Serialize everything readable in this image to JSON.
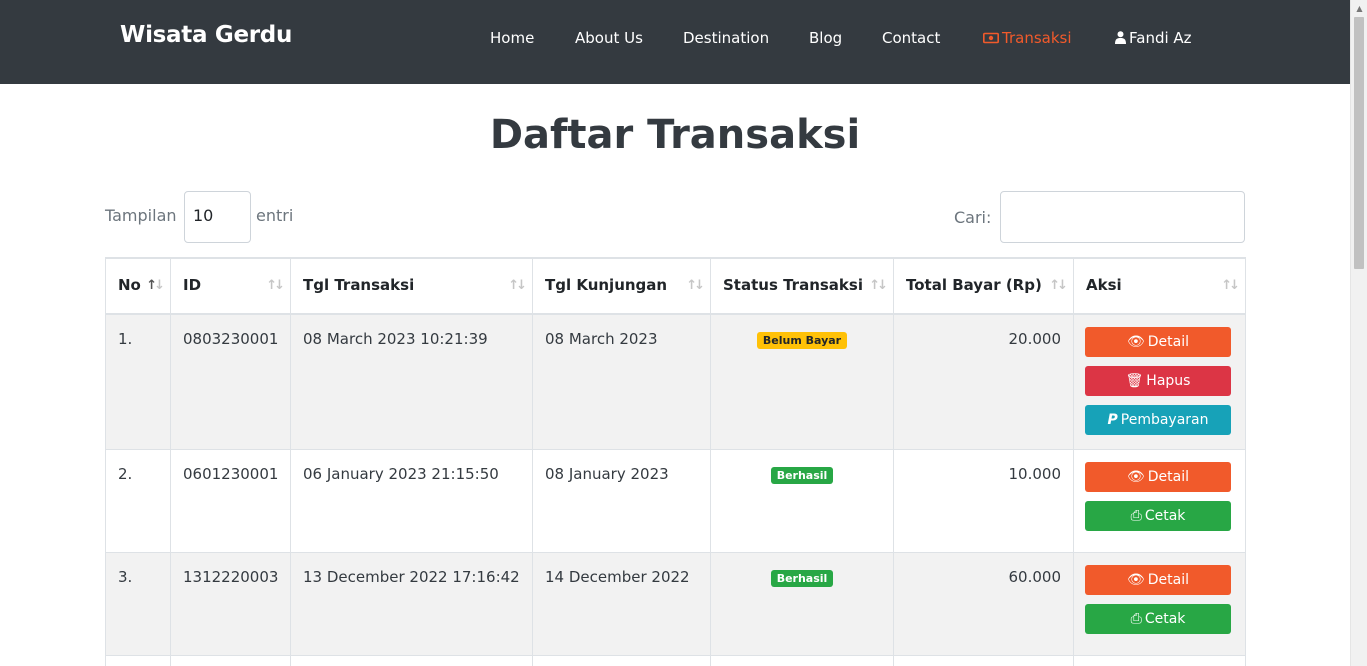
{
  "nav": {
    "brand": "Wisata Gerdu",
    "items": [
      {
        "label": "Home",
        "icon": null
      },
      {
        "label": "About Us",
        "icon": null
      },
      {
        "label": "Destination",
        "icon": null
      },
      {
        "label": "Blog",
        "icon": null
      },
      {
        "label": "Contact",
        "icon": null
      },
      {
        "label": "Transaksi",
        "icon": "money-icon",
        "active": true
      },
      {
        "label": "Fandi Az",
        "icon": "user-icon"
      }
    ],
    "colors": {
      "bar": "#343a40",
      "active": "#f15a2b"
    }
  },
  "page": {
    "title": "Daftar Transaksi",
    "length_prefix": "Tampilan",
    "length_value": "10",
    "length_suffix": "entri",
    "search_label": "Cari:",
    "search_value": ""
  },
  "table": {
    "headers": [
      "No",
      "ID",
      "Tgl Transaksi",
      "Tgl Kunjungan",
      "Status Transaksi",
      "Total Bayar (Rp)",
      "Aksi"
    ],
    "rows": [
      {
        "no": "1.",
        "id": "0803230001",
        "tgl_transaksi": "08 March 2023 10:21:39",
        "tgl_kunjungan": "08 March 2023",
        "status": "Belum Bayar",
        "status_color": "#ffc107",
        "total": "20.000",
        "actions": [
          "Detail",
          "Hapus",
          "Pembayaran"
        ]
      },
      {
        "no": "2.",
        "id": "0601230001",
        "tgl_transaksi": "06 January 2023 21:15:50",
        "tgl_kunjungan": "08 January 2023",
        "status": "Berhasil",
        "status_color": "#28a745",
        "total": "10.000",
        "actions": [
          "Detail",
          "Cetak"
        ]
      },
      {
        "no": "3.",
        "id": "1312220003",
        "tgl_transaksi": "13 December 2022 17:16:42",
        "tgl_kunjungan": "14 December 2022",
        "status": "Berhasil",
        "status_color": "#28a745",
        "total": "60.000",
        "actions": [
          "Detail",
          "Cetak"
        ]
      }
    ]
  }
}
